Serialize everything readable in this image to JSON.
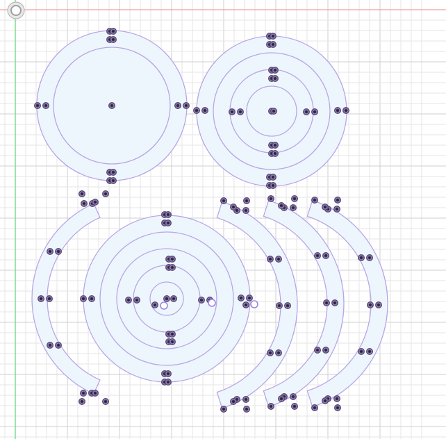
{
  "canvas": {
    "background": "#ffffff",
    "grid_minor_color": "#e6e6e6",
    "grid_major_color": "#cfcfcf",
    "x_axis_color": "#f08a8a",
    "y_axis_color": "#7ddc8f",
    "tool_icon": "circle-tool-icon"
  },
  "style": {
    "shape_fill": "#eef6fd",
    "shape_stroke": "#b7a6e6",
    "node_outer": "#5a4a78",
    "node_inner": "#2a2140",
    "node_ring": "#ffffff",
    "selected_ring": "#9d86e8"
  },
  "shapes": [
    {
      "kind": "concentric-circles",
      "name": "circle-group-1",
      "ring_count": 2
    },
    {
      "kind": "concentric-circles",
      "name": "circle-group-2",
      "ring_count": 4
    },
    {
      "kind": "concentric-circles",
      "name": "circle-group-3",
      "ring_count": 5
    },
    {
      "kind": "arc-band",
      "name": "arc-band-left"
    },
    {
      "kind": "arc-band",
      "name": "arc-band-right-1"
    },
    {
      "kind": "arc-band",
      "name": "arc-band-right-2"
    },
    {
      "kind": "arc-band",
      "name": "arc-band-right-3"
    }
  ]
}
